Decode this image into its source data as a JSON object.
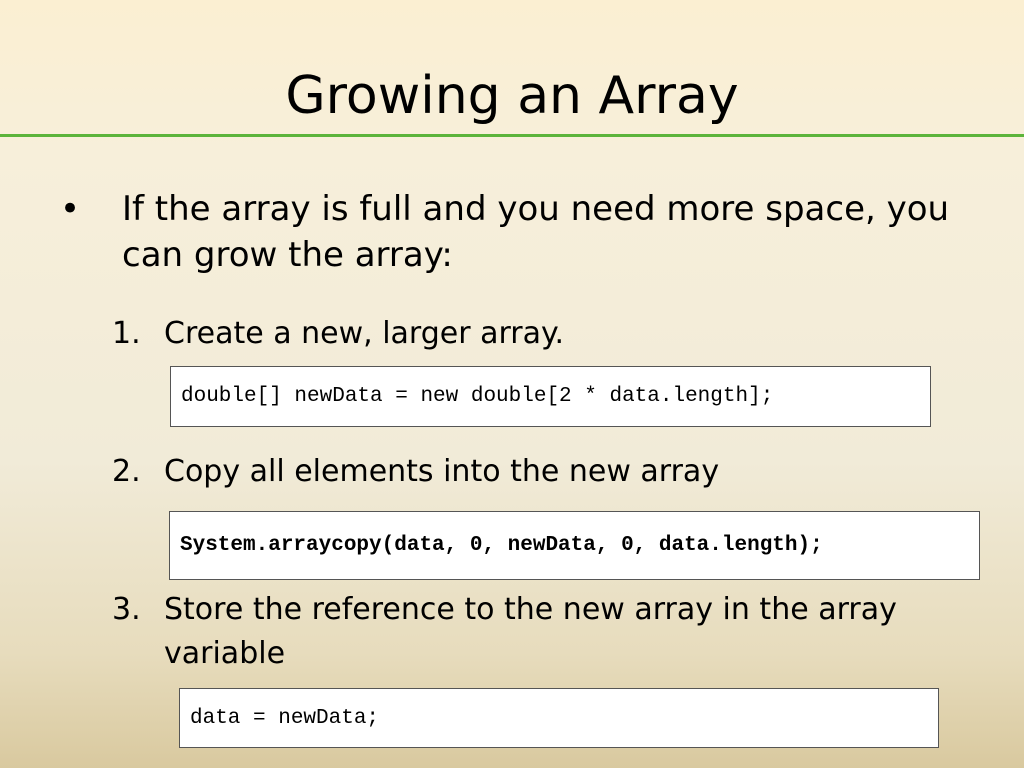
{
  "slide": {
    "title": "Growing an Array",
    "bullet": "If the array is full and you need more space, you can grow the array:",
    "steps": [
      {
        "number": "1.",
        "text": "Create a new, larger array.",
        "code": "double[] newData = new double[2 * data.length];"
      },
      {
        "number": "2.",
        "text": "Copy all elements into the new array",
        "code": "System.arraycopy(data, 0, newData, 0, data.length);"
      },
      {
        "number": "3.",
        "text": "Store the reference to the new array in the array variable",
        "code": "data = newData;"
      }
    ]
  },
  "colors": {
    "divider": "#5cb43b",
    "background_top": "#fbefd2",
    "background_bottom": "#d9c99f"
  }
}
